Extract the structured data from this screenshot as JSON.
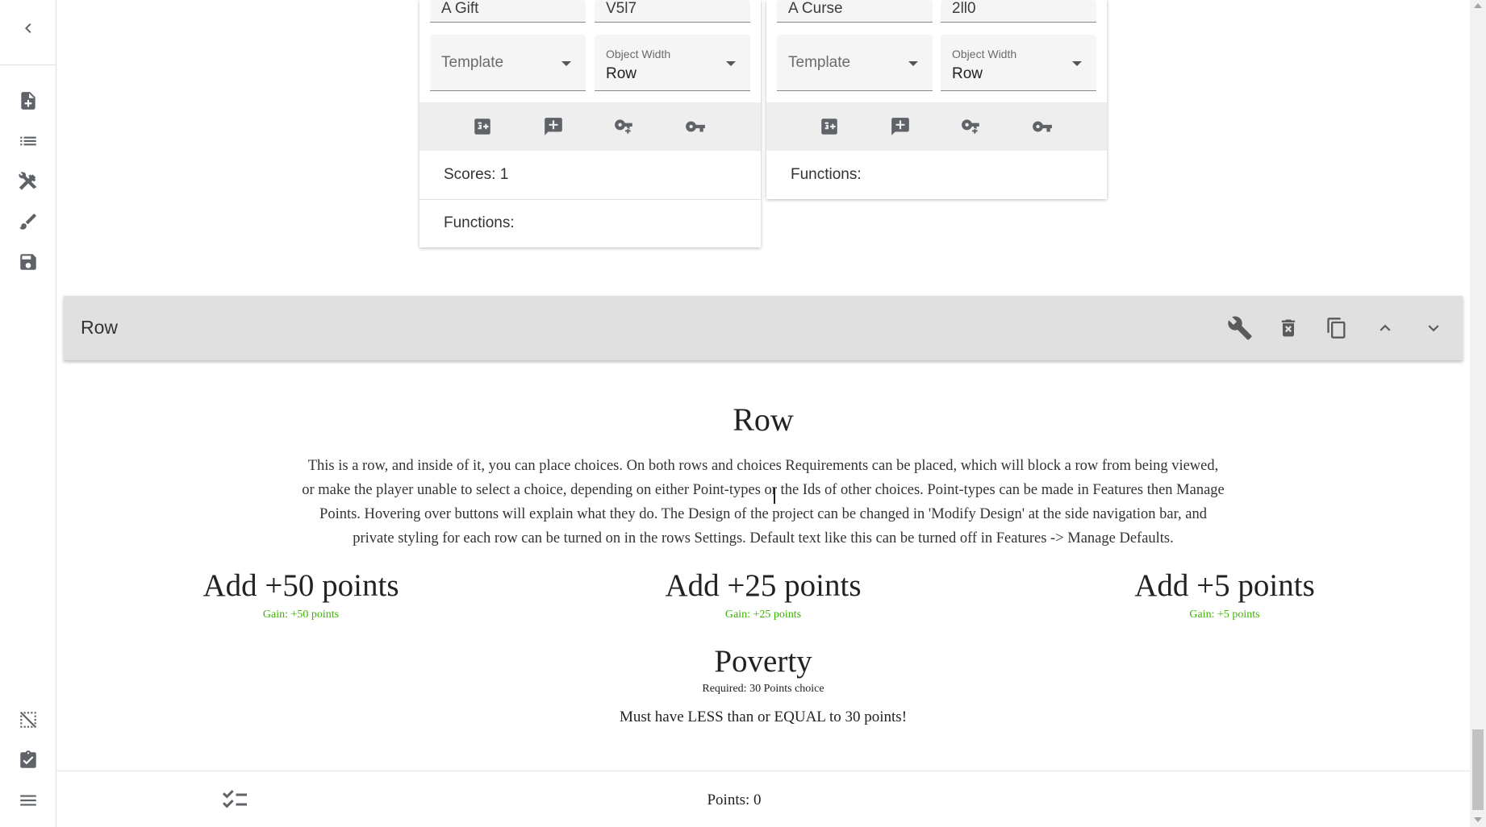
{
  "choice_cards": [
    {
      "title_value": "A Gift",
      "id_value": "V5l7",
      "template_placeholder": "Template",
      "object_width_label": "Object Width",
      "object_width_value": "Row",
      "scores_text": "Scores: 1",
      "functions_text": "Functions:"
    },
    {
      "title_value": "A Curse",
      "id_value": "2ll0",
      "template_placeholder": "Template",
      "object_width_label": "Object Width",
      "object_width_value": "Row",
      "functions_text": "Functions:"
    }
  ],
  "row_bar": {
    "title": "Row"
  },
  "row_content": {
    "heading": "Row",
    "description_lines": [
      "This is a row, and inside of it, you can place choices. On both rows and choices Requirements can be placed, which will block a row from being viewed,",
      "or make the player unable to select a choice, depending on either Point-types or the Ids of other choices. Point-types can be made in Features then Manage",
      "Points. Hovering over buttons will explain what they do. The Design of the project can be changed in 'Modify Design' at the side navigation bar, and",
      "private styling for each row can be turned on in the rows Settings. Default text like this can be turned off in Features -> Manage Defaults."
    ],
    "choices": [
      {
        "title": "Add +50 points",
        "gain": "Gain: +50  points"
      },
      {
        "title": "Add +25 points",
        "gain": "Gain: +25  points"
      },
      {
        "title": "Add +5 points",
        "gain": "Gain: +5  points"
      }
    ],
    "poverty": {
      "title": "Poverty",
      "requirement": "Required: 30 Points choice",
      "text": "Must have LESS than or EQUAL to 30 points!"
    }
  },
  "bottom_bar": {
    "points": "Points: 0"
  },
  "colors": {
    "gain": "#3bb300",
    "icon": "#5f6368",
    "row_bar_bg": "#e0e0e0",
    "toolbar_bg": "#eeeeee"
  },
  "icons": {
    "sidebar": [
      "chevron-left-icon",
      "note-add-icon",
      "list-icon",
      "tools-icon",
      "brush-icon",
      "save-icon",
      "grid-off-icon",
      "clipboard-icon",
      "menu-icon"
    ],
    "card_toolbar": [
      "add-score-icon",
      "add-comment-icon",
      "add-key-icon",
      "key-icon"
    ],
    "row_bar": [
      "wrench-icon",
      "delete-icon",
      "copy-icon",
      "chevron-up-icon",
      "chevron-down-icon"
    ],
    "bottom_bar": [
      "checklist-icon"
    ]
  }
}
